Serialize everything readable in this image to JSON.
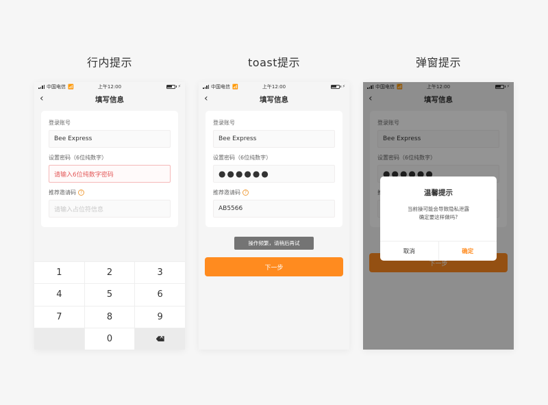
{
  "sections": [
    {
      "title": "行内提示"
    },
    {
      "title": "toast提示"
    },
    {
      "title": "弹窗提示"
    }
  ],
  "statusbar": {
    "carrier": "中国电信",
    "time": "上午12:00",
    "wifi_icon": "wifi-icon",
    "battery_icon": "battery-icon",
    "signal_icon": "signal-icon"
  },
  "navbar": {
    "title": "填写信息",
    "back_icon": "‹"
  },
  "form": {
    "account_label": "登录账号",
    "password_label": "设置密码（6位纯数字）",
    "invite_label": "推荐邀请码",
    "help_icon": "?"
  },
  "phone1": {
    "account_value": "Bee Express",
    "password_error": "请输入6位纯数字密码",
    "invite_placeholder": "请输入占位符信息",
    "keypad": [
      "1",
      "2",
      "3",
      "4",
      "5",
      "6",
      "7",
      "8",
      "9",
      "",
      "0",
      "⌫"
    ]
  },
  "phone2": {
    "account_value": "Bee Express",
    "password_value": "●●●●●●",
    "invite_value": "AB5566",
    "toast": "操作频繁，请稍后再试",
    "next_button": "下一步"
  },
  "phone3": {
    "account_value": "Bee Express",
    "password_value": "●●●●●●",
    "invite_value": "",
    "next_button": "下一步",
    "dialog": {
      "title": "温馨提示",
      "message_line1": "当前操可能会导致隐私泄露",
      "message_line2": "确定要这样做吗?",
      "cancel": "取消",
      "confirm": "确定"
    }
  },
  "colors": {
    "accent": "#ff8b1f",
    "error": "#e35a5a",
    "toast_bg": "#747474"
  }
}
